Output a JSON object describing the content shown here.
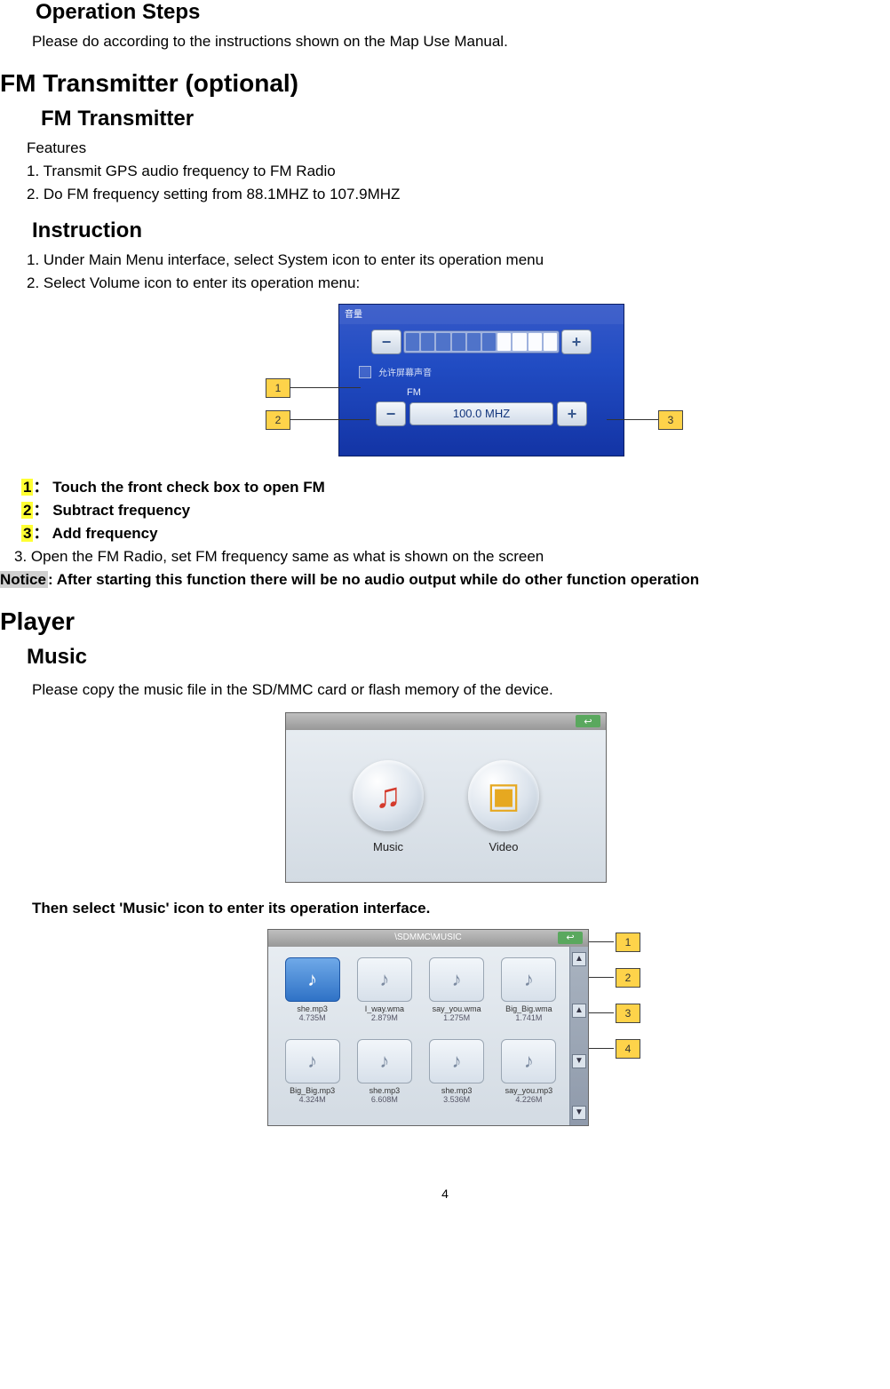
{
  "page_number": "4",
  "sections": {
    "operation_steps": {
      "heading": "Operation Steps",
      "body": "Please do according to the instructions shown on the Map Use Manual."
    },
    "fm_transmitter": {
      "heading": "FM Transmitter (optional)",
      "sub_heading": "FM Transmitter",
      "features_label": "Features",
      "features": [
        "1. Transmit GPS audio frequency to FM Radio",
        "2. Do FM frequency setting from 88.1MHZ to 107.9MHZ"
      ],
      "instruction_heading": "Instruction",
      "instructions": [
        "1. Under Main Menu interface, select System icon to enter its operation menu",
        "2. Select Volume icon to enter its operation menu:"
      ],
      "fm_screen": {
        "title_cn": "音量",
        "flag_cn": "允许屏幕声音",
        "fm_label": "FM",
        "freq_display": "100.0 MHZ"
      },
      "callouts": {
        "c1": "1",
        "c2": "2",
        "c3": "3",
        "c1_text": "Touch the front check box to open FM",
        "c2_text": "Subtract frequency",
        "c3_text": "Add frequency"
      },
      "step3": "3. Open the FM Radio, set FM frequency same as what is shown on the screen",
      "notice_prefix": "Notice",
      "notice_rest": ": After starting this function there will be no audio output while do other function operation"
    },
    "player": {
      "heading": "Player",
      "music_heading": "Music",
      "intro": "Please copy the music file in the SD/MMC card or flash memory of the device.",
      "menu": {
        "music_label": "Music",
        "video_label": "Video"
      },
      "then_select": "Then select 'Music' icon to enter its operation interface.",
      "music_list": {
        "title": "\\SDMMC\\MUSIC",
        "callouts": {
          "c1": "1",
          "c2": "2",
          "c3": "3",
          "c4": "4"
        },
        "files": [
          {
            "name": "she.mp3",
            "size": "4.735M",
            "selected": true
          },
          {
            "name": "I_way.wma",
            "size": "2.879M",
            "selected": false
          },
          {
            "name": "say_you.wma",
            "size": "1.275M",
            "selected": false
          },
          {
            "name": "Big_Big.wma",
            "size": "1.741M",
            "selected": false
          },
          {
            "name": "Big_Big.mp3",
            "size": "4.324M",
            "selected": false
          },
          {
            "name": "she.mp3",
            "size": "6.608M",
            "selected": false
          },
          {
            "name": "she.mp3",
            "size": "3.536M",
            "selected": false
          },
          {
            "name": "say_you.mp3",
            "size": "4.226M",
            "selected": false
          }
        ]
      }
    }
  }
}
